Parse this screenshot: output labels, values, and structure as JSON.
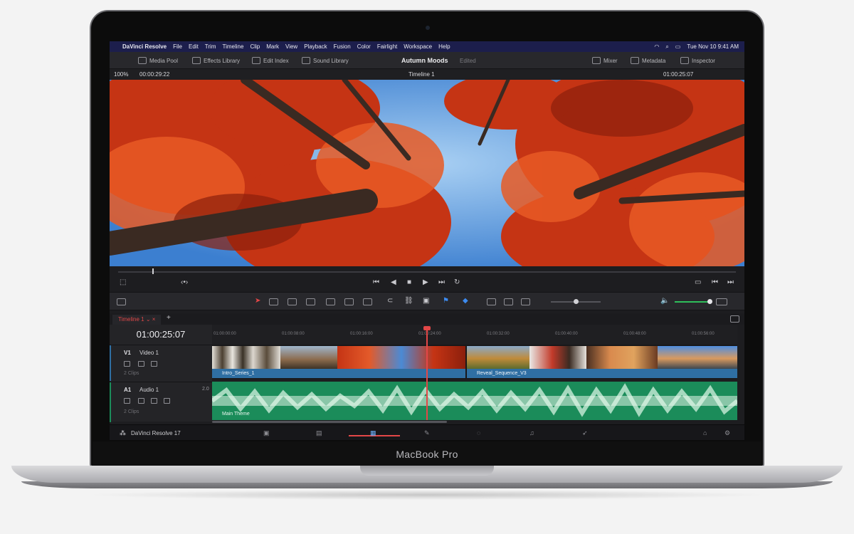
{
  "device": {
    "label": "MacBook Pro"
  },
  "menubar": {
    "items": [
      "DaVinci Resolve",
      "File",
      "Edit",
      "Trim",
      "Timeline",
      "Clip",
      "Mark",
      "View",
      "Playback",
      "Fusion",
      "Color",
      "Fairlight",
      "Workspace",
      "Help"
    ],
    "clock": "Tue Nov 10  9:41 AM"
  },
  "toolbar": {
    "media_pool": "Media Pool",
    "effects_library": "Effects Library",
    "edit_index": "Edit Index",
    "sound_library": "Sound Library",
    "project_title": "Autumn Moods",
    "project_status": "Edited",
    "mixer": "Mixer",
    "metadata": "Metadata",
    "inspector": "Inspector"
  },
  "viewer": {
    "zoom": "100%",
    "source_timecode": "00:00:29:22",
    "timeline_name": "Timeline 1",
    "record_timecode": "01:00:25:07"
  },
  "timeline": {
    "tab": "Timeline 1",
    "timecode": "01:00:25:07",
    "ruler": [
      "01:00:00:00",
      "01:00:08:00",
      "01:00:16:00",
      "01:00:24:00",
      "01:00:32:00",
      "01:00:40:00",
      "01:00:48:00",
      "01:00:56:00"
    ],
    "video_track": {
      "id": "V1",
      "name": "Video 1",
      "clips_count": "2 Clips"
    },
    "audio_track": {
      "id": "A1",
      "name": "Audio 1",
      "clips_count": "2 Clips",
      "level": "2.0"
    },
    "video_clips": [
      "Intro_Series_1",
      "Reveal_Sequence_V3"
    ],
    "audio_clip": "Main Theme"
  },
  "footer": {
    "app_name": "DaVinci Resolve 17"
  },
  "colors": {
    "menubar": "#1c1e4c",
    "accent_red": "#e34747",
    "video_clip": "#2f6fa3",
    "audio_clip": "#1b8c5a"
  }
}
